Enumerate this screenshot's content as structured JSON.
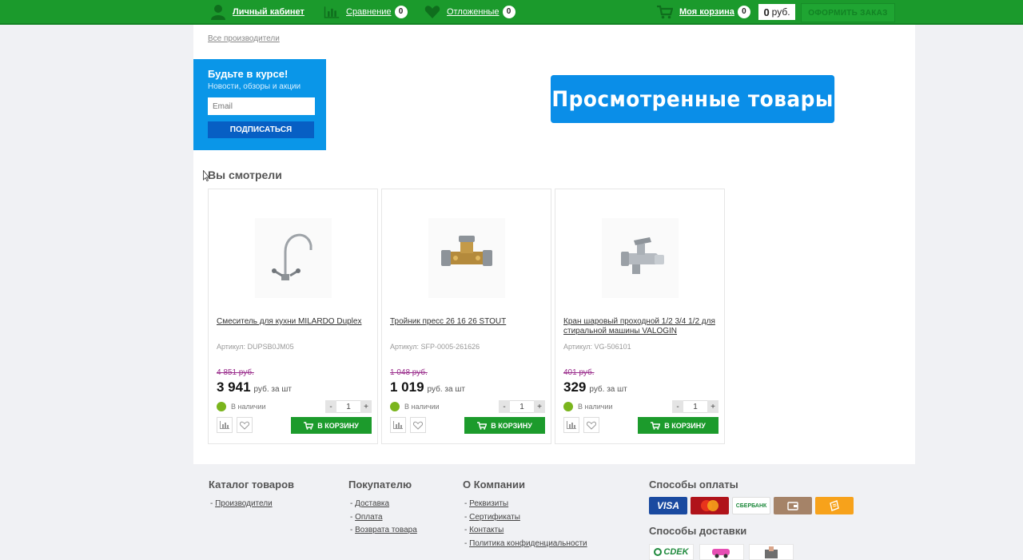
{
  "topbar": {
    "account": "Личный кабинет",
    "compare": "Сравнение",
    "compare_count": "0",
    "deferred": "Отложенные",
    "deferred_count": "0",
    "cart": "Моя корзина",
    "cart_count": "0",
    "cart_total_value": "0",
    "cart_total_unit": "руб.",
    "order_button": "ОФОРМИТЬ ЗАКАЗ"
  },
  "all_makers_link": "Все производители",
  "subscribe": {
    "title": "Будьте в курсе!",
    "text": "Новости, обзоры и акции",
    "placeholder": "Email",
    "button": "ПОДПИСАТЬСЯ"
  },
  "banner": "Просмотренные товары",
  "viewed_title": "Вы смотрели",
  "products": [
    {
      "name": "Смеситель для кухни MILARDO Duplex",
      "sku": "Артикул: DUPSB0JM05",
      "old_price": "4 851 руб.",
      "price": "3 941",
      "unit": "руб. за шт",
      "stock": "В наличии",
      "qty": "1",
      "cart_button": "В КОРЗИНУ"
    },
    {
      "name": "Тройник пресс 26 16 26 STOUT",
      "sku": "Артикул: SFP-0005-261626",
      "old_price": "1 048 руб.",
      "price": "1 019",
      "unit": "руб. за шт",
      "stock": "В наличии",
      "qty": "1",
      "cart_button": "В КОРЗИНУ"
    },
    {
      "name": "Кран шаровый проходной 1/2 3/4 1/2 для стиральной машины VALOGIN",
      "sku": "Артикул: VG-506101",
      "old_price": "401 руб.",
      "price": "329",
      "unit": "руб. за шт",
      "stock": "В наличии",
      "qty": "1",
      "cart_button": "В КОРЗИНУ"
    }
  ],
  "footer": {
    "catalog": {
      "title": "Каталог товаров",
      "links": [
        "Производители"
      ]
    },
    "buyer": {
      "title": "Покупателю",
      "links": [
        "Доставка",
        "Оплата",
        "Возврата товара"
      ]
    },
    "company": {
      "title": "О Компании",
      "links": [
        "Реквизиты",
        "Сертификаты",
        "Контакты",
        "Политика конфиденциальности"
      ]
    },
    "payment_title": "Способы оплаты",
    "payment_methods": [
      "VISA",
      "MasterCard",
      "СБЕРБАНК",
      "wallet",
      "yandex"
    ],
    "delivery_title": "Способы доставки",
    "delivery_methods": [
      "СDEK",
      "courier",
      "parcel"
    ]
  },
  "colors": {
    "topbar_green": "#1b9a2c",
    "accent_blue": "#0a96e8",
    "cart_green": "#1c9b2c",
    "old_price": "#9a2e8c"
  }
}
